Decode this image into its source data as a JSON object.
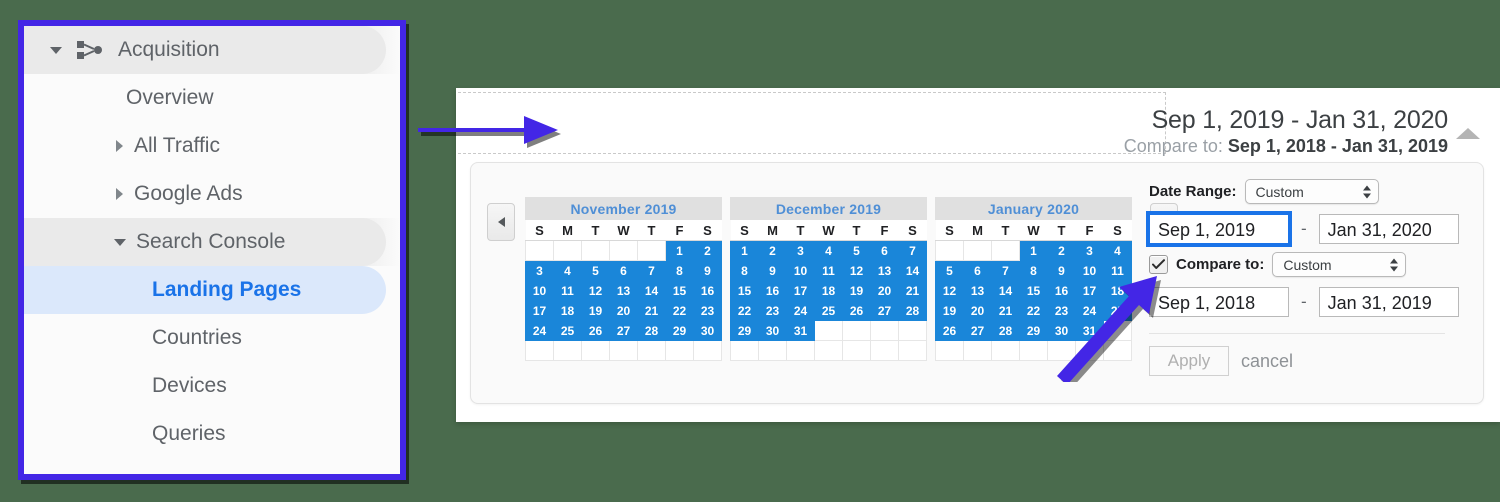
{
  "sidebar": {
    "items": [
      {
        "label": "Acquisition",
        "icon": "share-nodes-icon",
        "state": "expanded",
        "level": 0
      },
      {
        "label": "Overview",
        "icon": "none",
        "state": "plain",
        "level": 1
      },
      {
        "label": "All Traffic",
        "icon": "caret-right-icon",
        "state": "collapsed",
        "level": 1
      },
      {
        "label": "Google Ads",
        "icon": "caret-right-icon",
        "state": "collapsed",
        "level": 1
      },
      {
        "label": "Search Console",
        "icon": "caret-down-icon",
        "state": "expanded",
        "level": 1
      },
      {
        "label": "Landing Pages",
        "icon": "none",
        "state": "selected",
        "level": 2
      },
      {
        "label": "Countries",
        "icon": "none",
        "state": "plain",
        "level": 2
      },
      {
        "label": "Devices",
        "icon": "none",
        "state": "plain",
        "level": 2
      },
      {
        "label": "Queries",
        "icon": "none",
        "state": "plain",
        "level": 2
      }
    ]
  },
  "header": {
    "range_primary": "Sep 1, 2019 - Jan 31, 2020",
    "compare_prefix": "Compare to: ",
    "compare_range": "Sep 1, 2018 - Jan 31, 2019",
    "collapse_icon": "triangle-up-icon"
  },
  "picker": {
    "prev_icon": "chevron-left-icon",
    "next_icon": "chevron-right-icon",
    "weekdays": [
      "S",
      "M",
      "T",
      "W",
      "T",
      "F",
      "S"
    ],
    "months": [
      {
        "title": "November 2019",
        "weeks": [
          [
            null,
            null,
            null,
            null,
            null,
            1,
            2
          ],
          [
            3,
            4,
            5,
            6,
            7,
            8,
            9
          ],
          [
            10,
            11,
            12,
            13,
            14,
            15,
            16
          ],
          [
            17,
            18,
            19,
            20,
            21,
            22,
            23
          ],
          [
            24,
            25,
            26,
            27,
            28,
            29,
            30
          ],
          [
            null,
            null,
            null,
            null,
            null,
            null,
            null
          ]
        ],
        "selected": [
          1,
          2,
          3,
          4,
          5,
          6,
          7,
          8,
          9,
          10,
          11,
          12,
          13,
          14,
          15,
          16,
          17,
          18,
          19,
          20,
          21,
          22,
          23,
          24,
          25,
          26,
          27,
          28,
          29,
          30
        ]
      },
      {
        "title": "December 2019",
        "weeks": [
          [
            1,
            2,
            3,
            4,
            5,
            6,
            7
          ],
          [
            8,
            9,
            10,
            11,
            12,
            13,
            14
          ],
          [
            15,
            16,
            17,
            18,
            19,
            20,
            21
          ],
          [
            22,
            23,
            24,
            25,
            26,
            27,
            28
          ],
          [
            29,
            30,
            31,
            null,
            null,
            null,
            null
          ],
          [
            null,
            null,
            null,
            null,
            null,
            null,
            null
          ]
        ],
        "selected": [
          1,
          2,
          3,
          4,
          5,
          6,
          7,
          8,
          9,
          10,
          11,
          12,
          13,
          14,
          15,
          16,
          17,
          18,
          19,
          20,
          21,
          22,
          23,
          24,
          25,
          26,
          27,
          28,
          29,
          30,
          31
        ]
      },
      {
        "title": "January 2020",
        "weeks": [
          [
            null,
            null,
            null,
            1,
            2,
            3,
            4
          ],
          [
            5,
            6,
            7,
            8,
            9,
            10,
            11
          ],
          [
            12,
            13,
            14,
            15,
            16,
            17,
            18
          ],
          [
            19,
            20,
            21,
            22,
            23,
            24,
            25
          ],
          [
            26,
            27,
            28,
            29,
            30,
            31,
            null
          ],
          [
            null,
            null,
            null,
            null,
            null,
            null,
            null
          ]
        ],
        "selected": [
          1,
          2,
          3,
          4,
          5,
          6,
          7,
          8,
          9,
          10,
          11,
          12,
          13,
          14,
          15,
          16,
          17,
          18,
          19,
          20,
          21,
          22,
          23,
          24,
          25,
          26,
          27,
          28,
          29,
          30,
          31
        ]
      }
    ]
  },
  "form": {
    "date_range_label": "Date Range:",
    "date_range_value": "Custom",
    "start_date": "Sep 1, 2019",
    "end_date": "Jan 31, 2020",
    "range_separator": "-",
    "compare_label": "Compare to:",
    "compare_checked": true,
    "compare_select_value": "Custom",
    "compare_start_date": "Sep 1, 2018",
    "compare_end_date": "Jan 31, 2019",
    "compare_separator": "-",
    "apply_label": "Apply",
    "cancel_label": "cancel"
  },
  "annotations": {
    "arrow_color": "#4326e6",
    "horizontal_arrow": "arrow-right",
    "diagonal_arrow": "arrow-up-right"
  },
  "colors": {
    "accent_purple": "#4326e6",
    "selected_day_blue": "#1a86d9",
    "selected_nav_blue": "#1a73e8",
    "selected_nav_bg": "#dbe8fb",
    "page_background": "#4a6b4d"
  }
}
